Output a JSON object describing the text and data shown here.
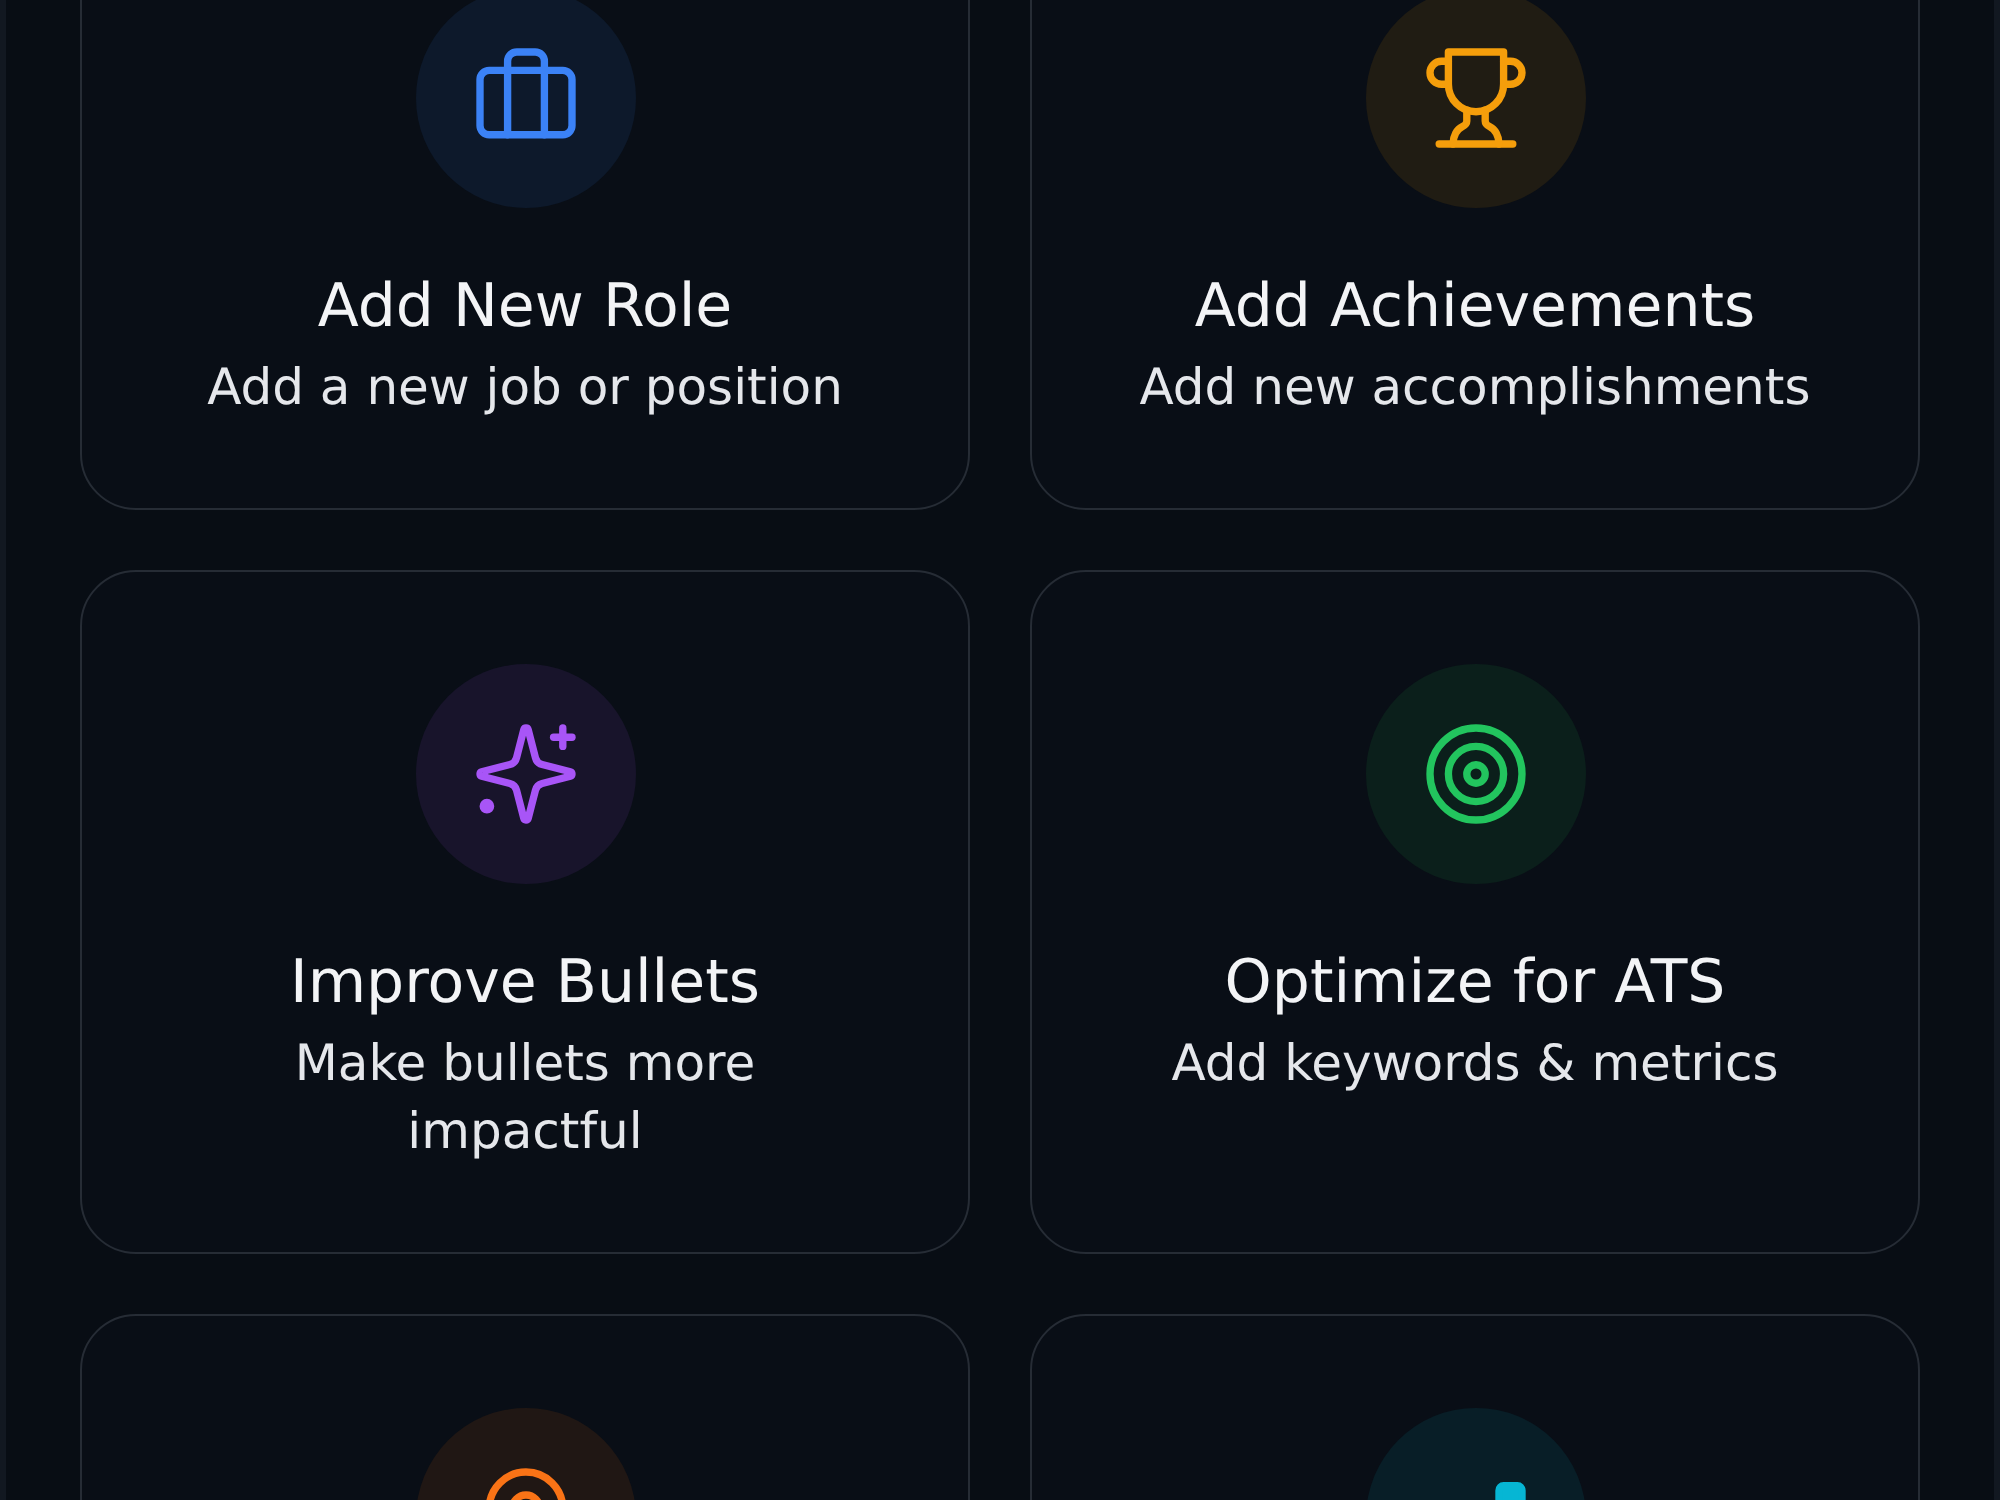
{
  "cards": [
    {
      "title": "Add New Role",
      "description": "Add a new job or position",
      "color": "#3b82f6"
    },
    {
      "title": "Add Achievements",
      "description": "Add new accomplishments",
      "color": "#f59e0b"
    },
    {
      "title": "Improve Bullets",
      "description": "Make bullets more impactful",
      "color": "#a855f7"
    },
    {
      "title": "Optimize for ATS",
      "description": "Add keywords & metrics",
      "color": "#22c55e"
    },
    {
      "color": "#f97316"
    },
    {
      "color": "#06b6d4"
    }
  ]
}
